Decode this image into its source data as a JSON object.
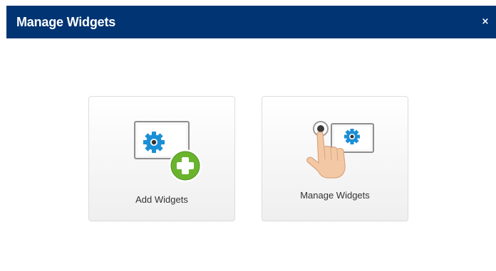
{
  "dialog": {
    "title": "Manage Widgets",
    "close_label": "×"
  },
  "cards": {
    "add": {
      "label": "Add Widgets",
      "icon": "add-widget-icon"
    },
    "manage": {
      "label": "Manage Widgets",
      "icon": "manage-widget-icon"
    }
  },
  "colors": {
    "title_bar": "#003473",
    "gear_blue": "#1a8fd6",
    "plus_green": "#6ab42d"
  }
}
